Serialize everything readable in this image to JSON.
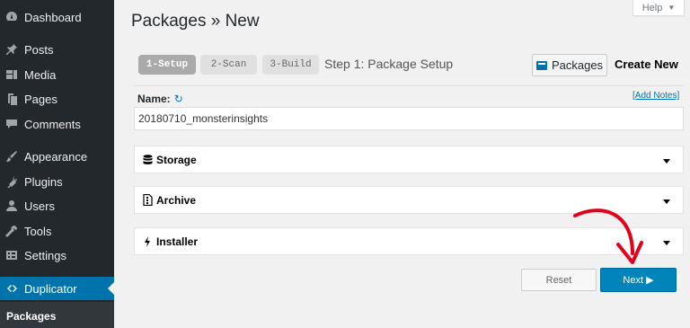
{
  "sidebar": {
    "items": [
      {
        "label": "Dashboard",
        "icon": "dashboard-icon"
      },
      {
        "label": "Posts",
        "icon": "pin-icon"
      },
      {
        "label": "Media",
        "icon": "media-icon"
      },
      {
        "label": "Pages",
        "icon": "pages-icon"
      },
      {
        "label": "Comments",
        "icon": "comments-icon"
      },
      {
        "label": "Appearance",
        "icon": "appearance-icon"
      },
      {
        "label": "Plugins",
        "icon": "plugins-icon"
      },
      {
        "label": "Users",
        "icon": "users-icon"
      },
      {
        "label": "Tools",
        "icon": "tools-icon"
      },
      {
        "label": "Settings",
        "icon": "settings-icon"
      },
      {
        "label": "Duplicator",
        "icon": "duplicator-icon"
      }
    ],
    "submenu": {
      "label": "Packages"
    }
  },
  "help": {
    "label": "Help",
    "caret": "▼"
  },
  "page": {
    "title": "Packages » New"
  },
  "steps": [
    {
      "label": "1-Setup",
      "state": "current"
    },
    {
      "label": "2-Scan",
      "state": "pending"
    },
    {
      "label": "3-Build",
      "state": "pending"
    }
  ],
  "step_title": "Step 1: Package Setup",
  "actions": {
    "packages_label": "Packages",
    "create_new_label": "Create New"
  },
  "name": {
    "label": "Name:",
    "value": "20180710_monsterinsights",
    "add_notes": "[Add Notes]"
  },
  "panels": [
    {
      "label": "Storage",
      "icon": "database-icon"
    },
    {
      "label": "Archive",
      "icon": "archive-file-icon"
    },
    {
      "label": "Installer",
      "icon": "bolt-icon"
    }
  ],
  "buttons": {
    "reset": "Reset",
    "next": "Next ▶"
  },
  "colors": {
    "accent": "#0073aa",
    "primary_button": "#0085ba",
    "annotation": "#e2001a"
  }
}
